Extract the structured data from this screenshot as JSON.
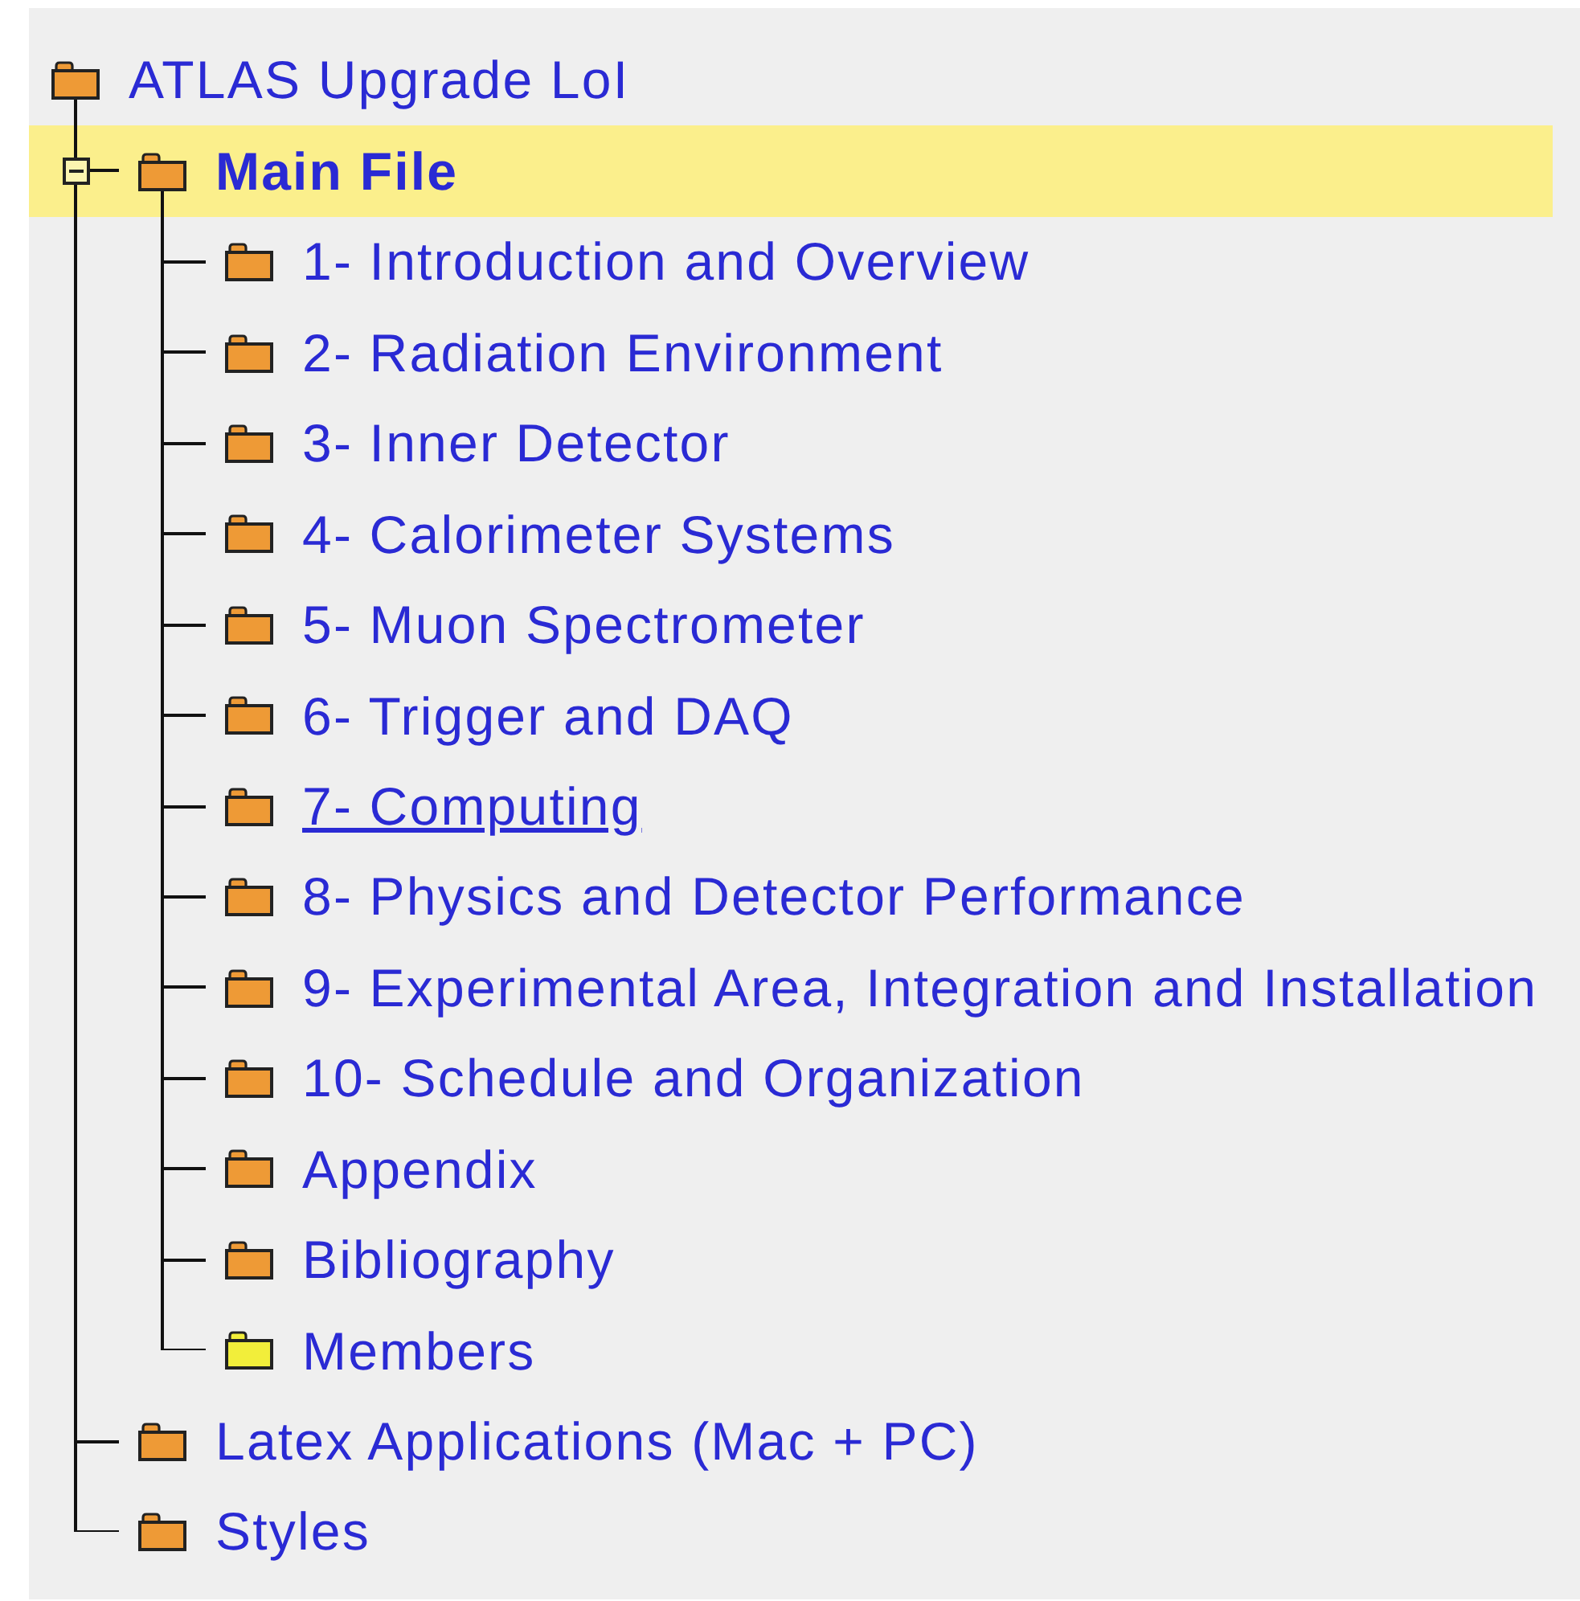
{
  "tree": {
    "label": "ATLAS Upgrade LoI",
    "color": "#ee9a36",
    "selected": false,
    "hovered": false,
    "children": [
      {
        "label": "Main File",
        "color": "#ee9a36",
        "selected": true,
        "hovered": false,
        "expanded": true,
        "children": [
          {
            "label": "1- Introduction and Overview",
            "color": "#ee9a36",
            "selected": false,
            "hovered": false
          },
          {
            "label": "2- Radiation Environment",
            "color": "#ee9a36",
            "selected": false,
            "hovered": false
          },
          {
            "label": "3- Inner Detector",
            "color": "#ee9a36",
            "selected": false,
            "hovered": false
          },
          {
            "label": "4- Calorimeter Systems",
            "color": "#ee9a36",
            "selected": false,
            "hovered": false
          },
          {
            "label": "5- Muon Spectrometer",
            "color": "#ee9a36",
            "selected": false,
            "hovered": false
          },
          {
            "label": "6- Trigger and DAQ",
            "color": "#ee9a36",
            "selected": false,
            "hovered": false
          },
          {
            "label": "7- Computing",
            "color": "#ee9a36",
            "selected": false,
            "hovered": true
          },
          {
            "label": "8- Physics and Detector Performance",
            "color": "#ee9a36",
            "selected": false,
            "hovered": false
          },
          {
            "label": "9- Experimental Area, Integration and Installation",
            "color": "#ee9a36",
            "selected": false,
            "hovered": false
          },
          {
            "label": "10- Schedule and Organization",
            "color": "#ee9a36",
            "selected": false,
            "hovered": false
          },
          {
            "label": "Appendix",
            "color": "#ee9a36",
            "selected": false,
            "hovered": false
          },
          {
            "label": "Bibliography",
            "color": "#ee9a36",
            "selected": false,
            "hovered": false
          },
          {
            "label": "Members",
            "color": "#f2ee3a",
            "selected": false,
            "hovered": false
          }
        ]
      },
      {
        "label": "Latex Applications (Mac + PC)",
        "color": "#ee9a36",
        "selected": false,
        "hovered": false
      },
      {
        "label": "Styles",
        "color": "#ee9a36",
        "selected": false,
        "hovered": false
      }
    ]
  }
}
